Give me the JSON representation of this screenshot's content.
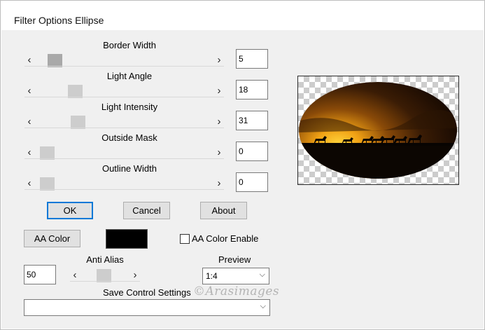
{
  "window": {
    "title": "Filter Options Ellipse"
  },
  "sliders": [
    {
      "label": "Border Width",
      "value": "5",
      "fraction": 0.05
    },
    {
      "label": "Light Angle",
      "value": "18",
      "fraction": 0.18
    },
    {
      "label": "Light Intensity",
      "value": "31",
      "fraction": 0.2
    },
    {
      "label": "Outside Mask",
      "value": "0",
      "fraction": 0.0
    },
    {
      "label": "Outline Width",
      "value": "0",
      "fraction": 0.0
    }
  ],
  "icons": {
    "left": "‹",
    "right": "›",
    "chevron": "⌵"
  },
  "buttons": {
    "ok": "OK",
    "cancel": "Cancel",
    "about": "About",
    "aa_color": "AA Color"
  },
  "aa_color": {
    "swatch_color": "#000000"
  },
  "aa_color_enable": {
    "label": "AA Color Enable",
    "checked": false
  },
  "anti_alias": {
    "label": "Anti Alias",
    "value": "50",
    "fraction": 0.45
  },
  "preview": {
    "label": "Preview",
    "selected": "1:4"
  },
  "save_settings": {
    "label": "Save Control Settings",
    "selected": ""
  },
  "watermark": {
    "text": "©Arasimages"
  },
  "colors": {
    "accent": "#0078d7",
    "panel": "#f0f0f0"
  }
}
